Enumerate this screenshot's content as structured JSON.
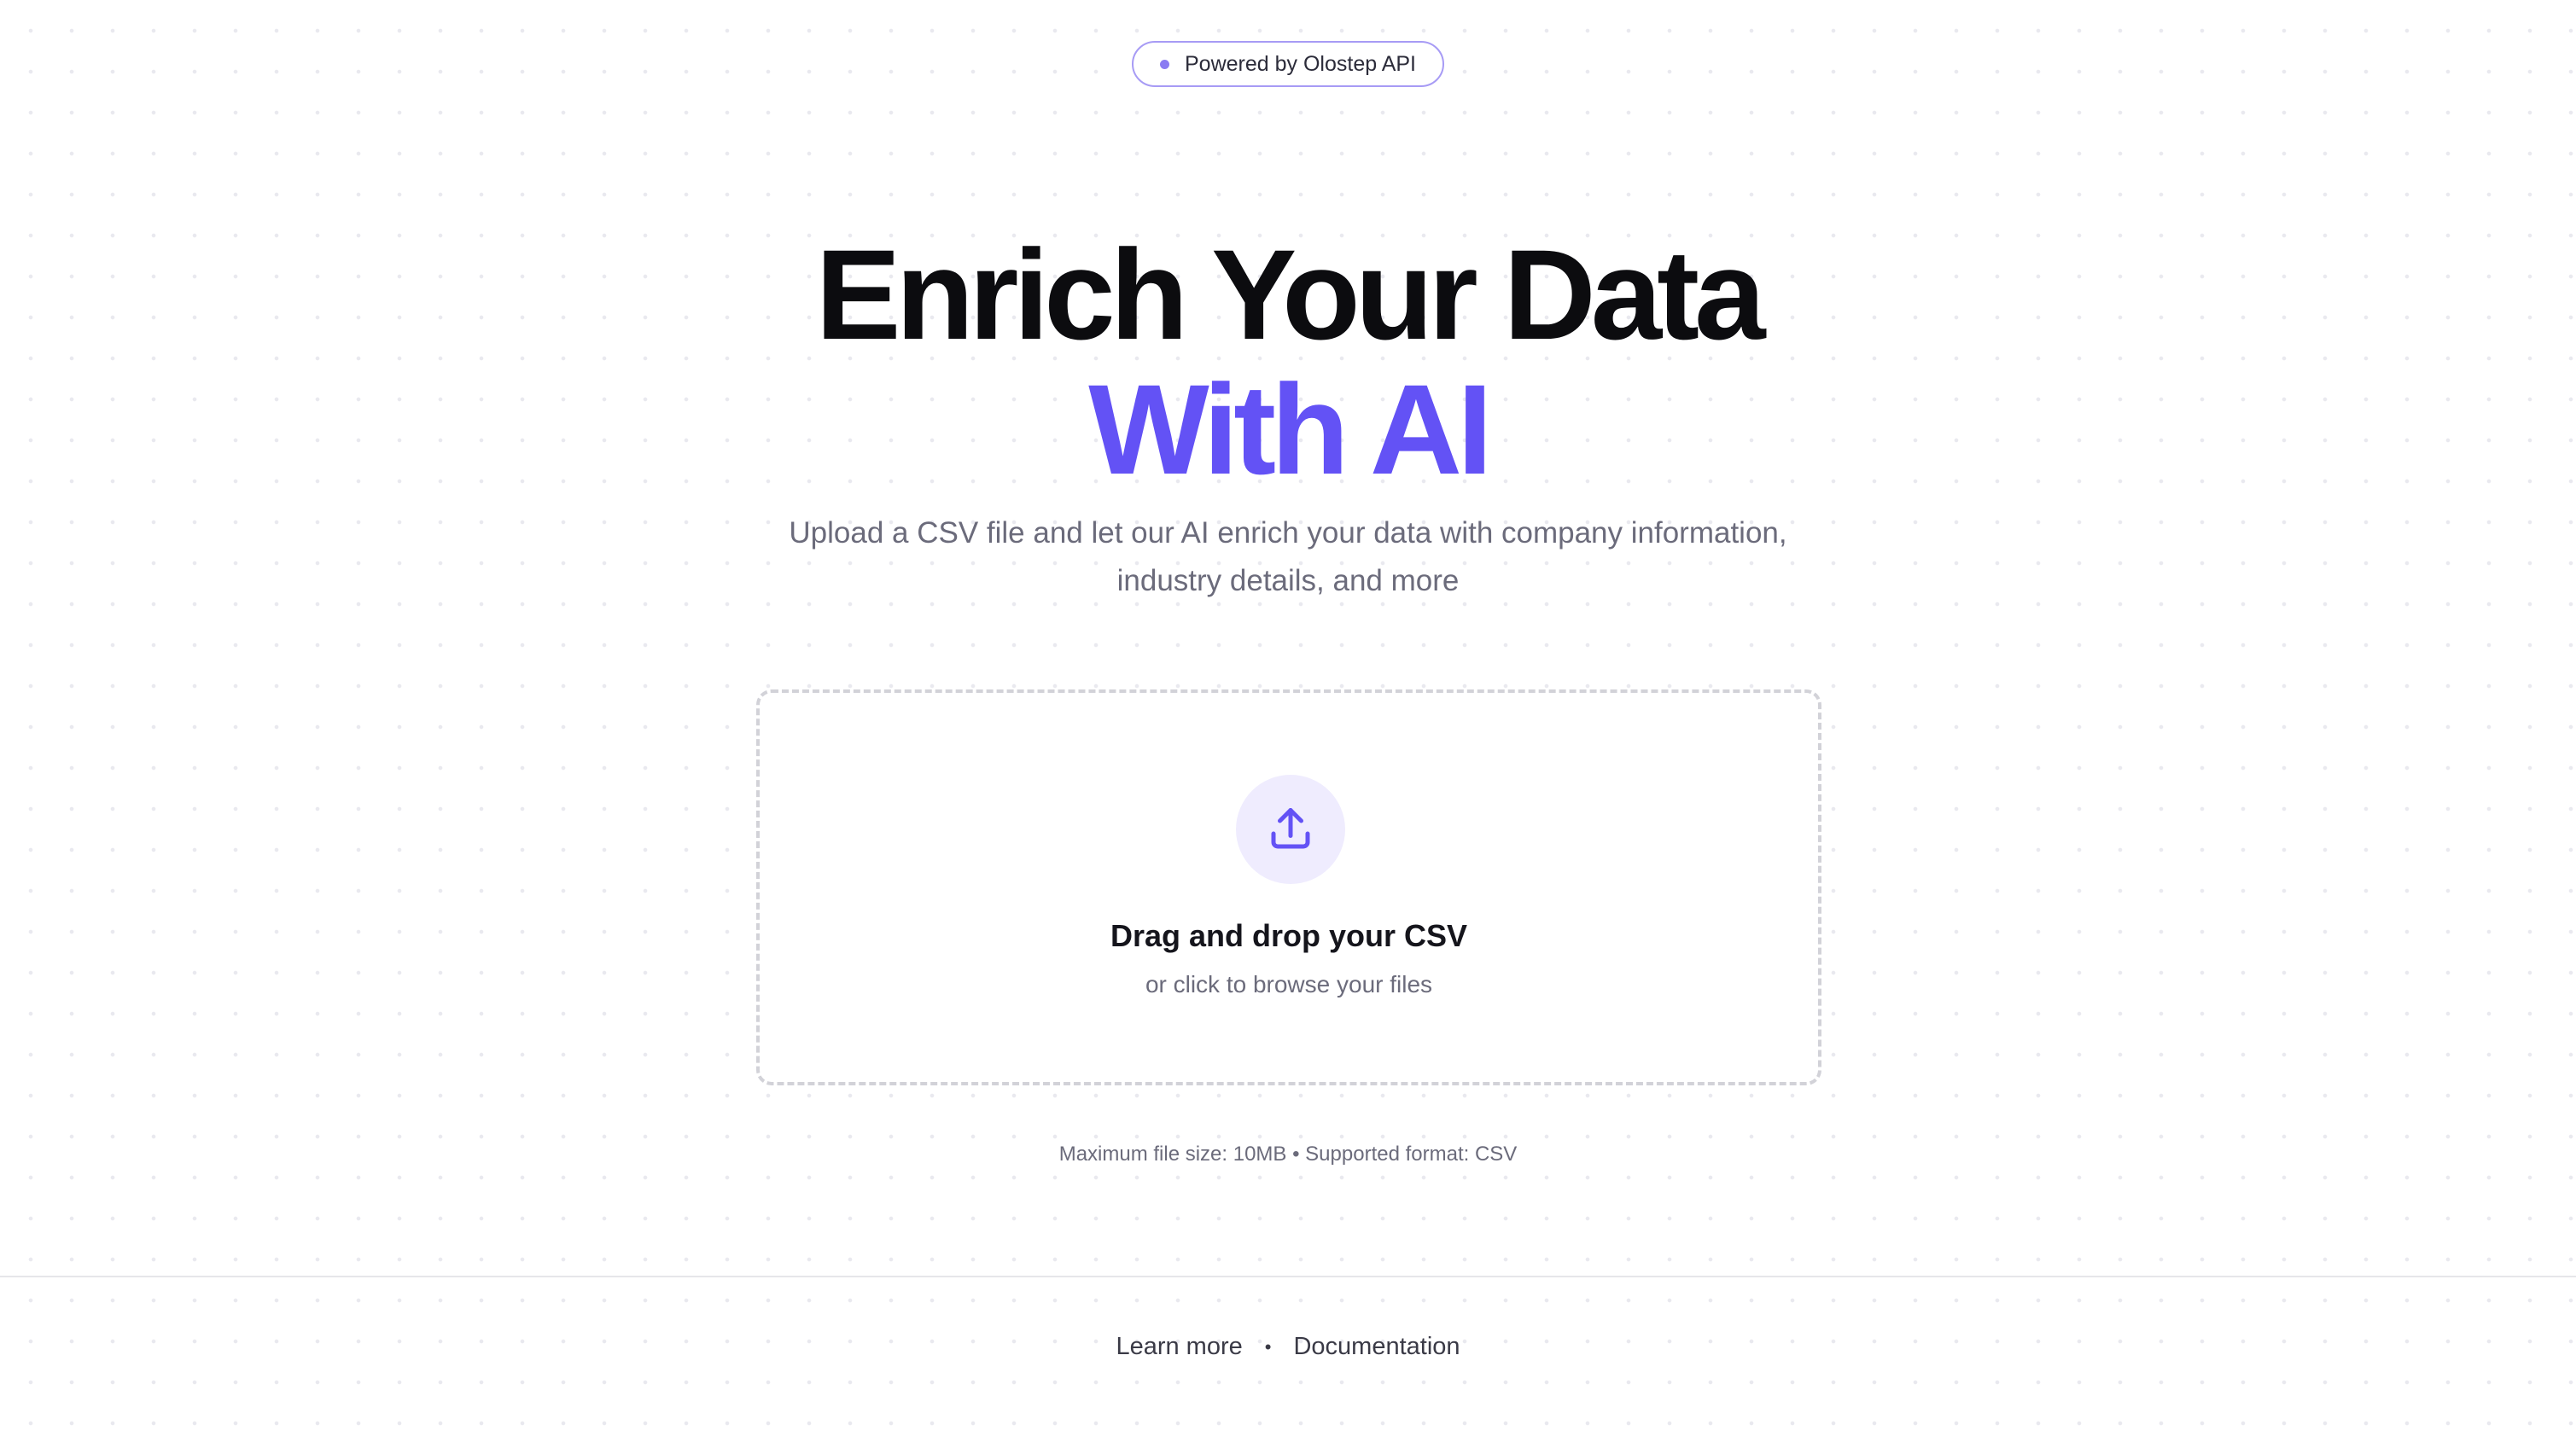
{
  "badge": {
    "label": "Powered by Olostep API",
    "dot_color": "#8b7cf2"
  },
  "hero": {
    "line1": "Enrich Your Data",
    "line2": "With AI",
    "accent_color": "#6352f5"
  },
  "subtitle": {
    "line1": "Upload a CSV file and let our AI enrich your data with company information,",
    "line2": "industry details, and more"
  },
  "dropzone": {
    "icon": "upload-icon",
    "title": "Drag and drop your CSV",
    "subtitle": "or click to browse your files"
  },
  "limits": {
    "text": "Maximum file size: 10MB • Supported format: CSV"
  },
  "footer": {
    "links": [
      "Learn more",
      "Documentation"
    ],
    "separator": "•"
  }
}
